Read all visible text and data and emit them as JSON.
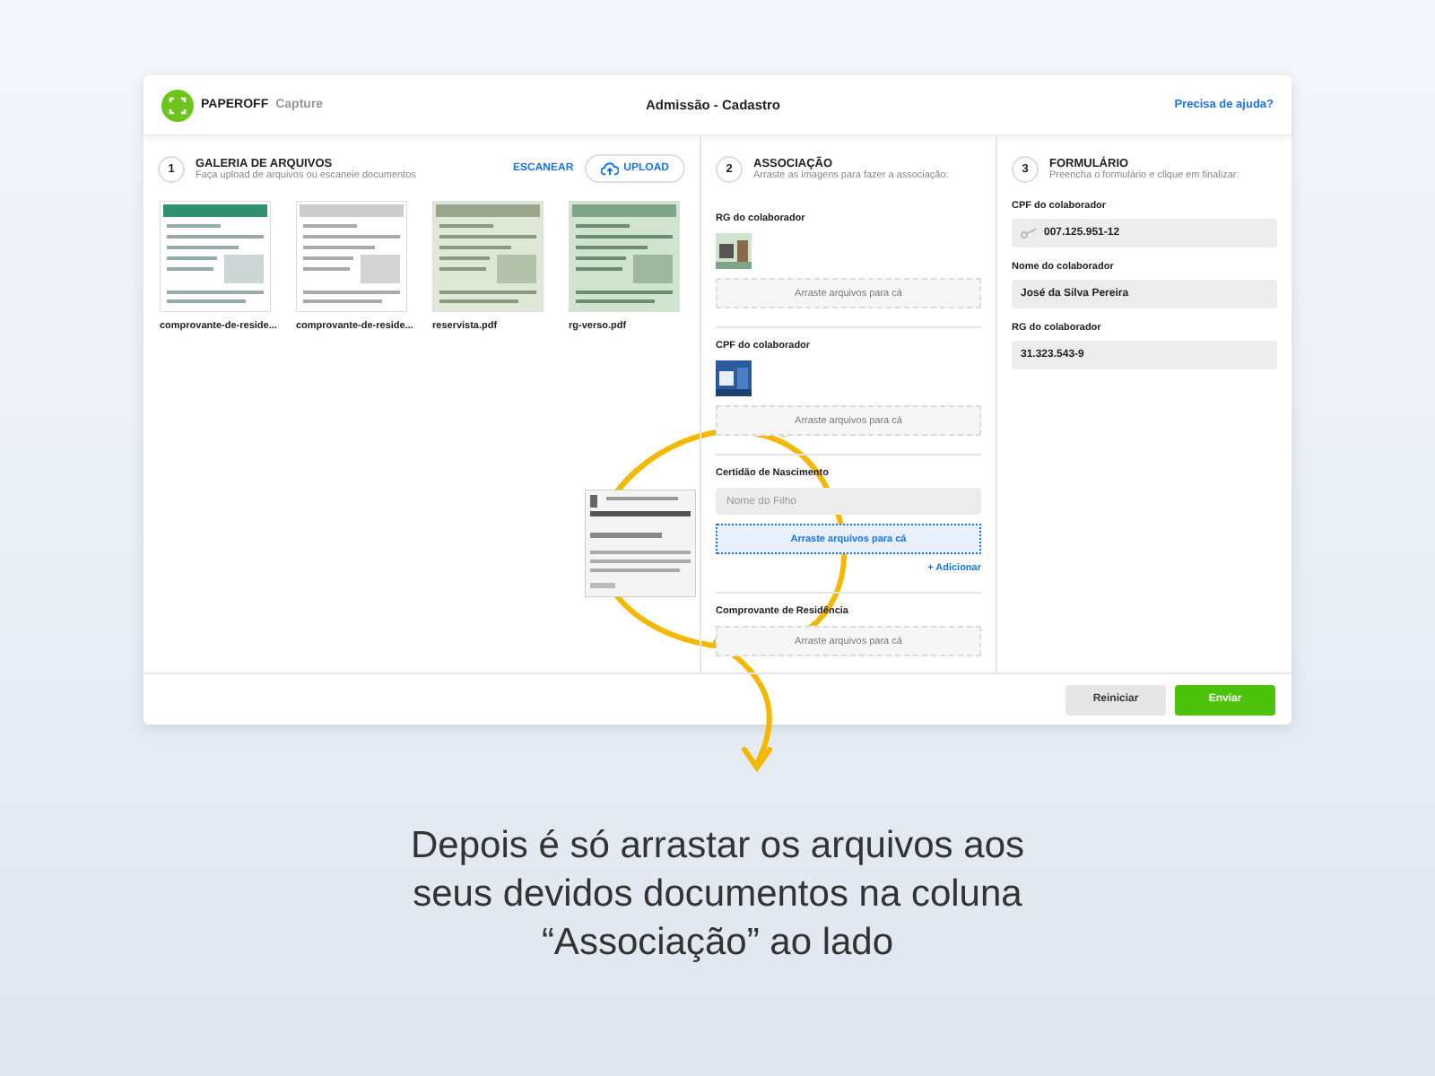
{
  "header": {
    "brand": "PAPEROFF",
    "product": "Capture",
    "title": "Admissão - Cadastro",
    "help_link": "Precisa de ajuda?"
  },
  "gallery": {
    "step": "1",
    "title": "GALERIA DE ARQUIVOS",
    "subtitle": "Faça upload de arquivos ou escaneie documentos",
    "scan_button": "ESCANEAR",
    "upload_button": "UPLOAD",
    "files": [
      {
        "name": "comprovante-de-reside..."
      },
      {
        "name": "comprovante-de-reside..."
      },
      {
        "name": "reservista.pdf"
      },
      {
        "name": "rg-verso.pdf"
      }
    ]
  },
  "association": {
    "step": "2",
    "title": "ASSOCIAÇÃO",
    "subtitle": "Arraste as imagens para fazer a associação:",
    "groups": [
      {
        "label": "RG do colaborador",
        "has_thumbnail": true,
        "drop_zone": "Arraste arquivos para cá",
        "highlighted": false
      },
      {
        "label": "CPF do colaborador",
        "has_thumbnail": true,
        "drop_zone": "Arraste arquivos para cá",
        "highlighted": false
      },
      {
        "label": "Certidão de Nascimento",
        "has_thumbnail": false,
        "placeholder": "Nome do Filho",
        "drop_zone": "Arraste arquivos para cá",
        "highlighted": true,
        "add_link": "+ Adicionar"
      },
      {
        "label": "Comprovante de Residência",
        "has_thumbnail": false,
        "drop_zone": "Arraste arquivos para cá",
        "highlighted": false
      }
    ]
  },
  "form": {
    "step": "3",
    "title": "FORMULÁRIO",
    "subtitle": "Preencha o formulário e clique em finalizar:",
    "fields": [
      {
        "label": "CPF do colaborador",
        "value": "007.125.951-12",
        "has_icon": true
      },
      {
        "label": "Nome do colaborador",
        "value": "José da Silva Pereira",
        "has_icon": false
      },
      {
        "label": "RG do colaborador",
        "value": "31.323.543-9",
        "has_icon": false
      }
    ]
  },
  "footer": {
    "buttons": [
      {
        "label": "Reiniciar",
        "kind": "secondary"
      },
      {
        "label": "Enviar",
        "kind": "primary"
      }
    ]
  },
  "caption": [
    "Depois é só arrastar os arquivos aos",
    "seus devidos documentos na coluna",
    "“Associação” ao lado"
  ]
}
